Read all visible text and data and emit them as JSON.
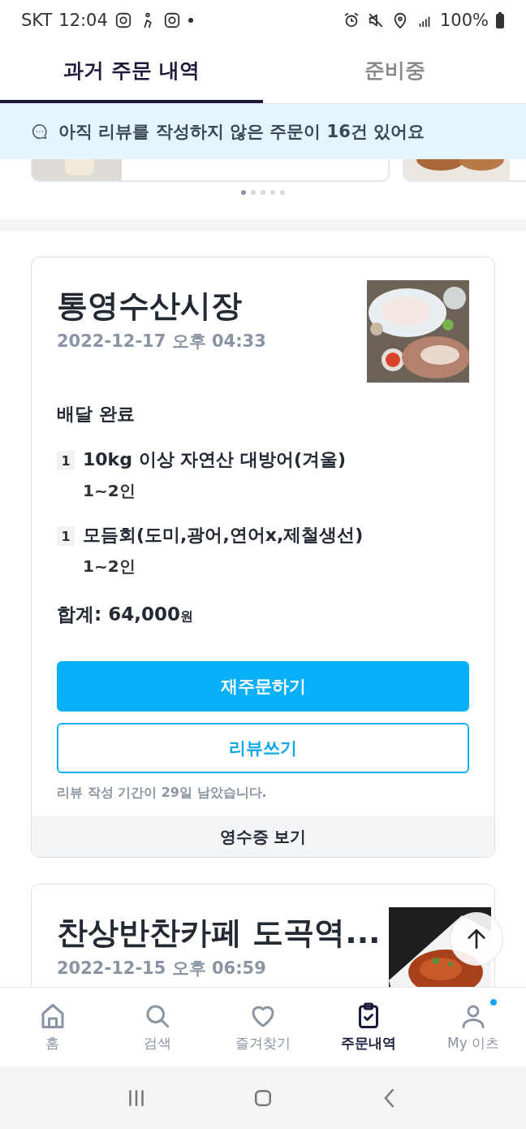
{
  "status_bar": {
    "carrier": "SKT",
    "time": "12:04",
    "battery": "100%"
  },
  "tabs": [
    {
      "label": "과거 주문 내역",
      "selected": true
    },
    {
      "label": "준비중",
      "selected": false
    }
  ],
  "banner": {
    "text": "아직 리뷰를 작성하지 않은 주문이 16건 있어요"
  },
  "carousel": {
    "dots": [
      {
        "selected": true
      },
      {
        "selected": false
      },
      {
        "selected": false
      },
      {
        "selected": false
      },
      {
        "selected": false
      }
    ]
  },
  "orders": [
    {
      "shop": "통영수산시장",
      "date": "2022-12-17 오후 04:33",
      "status": "배달 완료",
      "items": [
        {
          "qty": "1",
          "name": "10kg 이상 자연산 대방어(겨울)",
          "option": "1~2인"
        },
        {
          "qty": "1",
          "name": "모듬회(도미,광어,연어x,제철생선)",
          "option": "1~2인"
        }
      ],
      "total_label": "합계:",
      "total_amount": "64,000",
      "total_unit": "원",
      "reorder": "재주문하기",
      "review": "리뷰쓰기",
      "review_note": "리뷰 작성 기간이 29일 남았습니다.",
      "receipt": "영수증 보기"
    },
    {
      "shop": "찬상반찬카페 도곡역...",
      "date": "2022-12-15 오후 06:59"
    }
  ],
  "nav": [
    {
      "label": "홈",
      "selected": false,
      "badge": false
    },
    {
      "label": "검색",
      "selected": false,
      "badge": false
    },
    {
      "label": "즐겨찾기",
      "selected": false,
      "badge": false
    },
    {
      "label": "주문내역",
      "selected": true,
      "badge": false
    },
    {
      "label": "My 이츠",
      "selected": false,
      "badge": true
    }
  ]
}
